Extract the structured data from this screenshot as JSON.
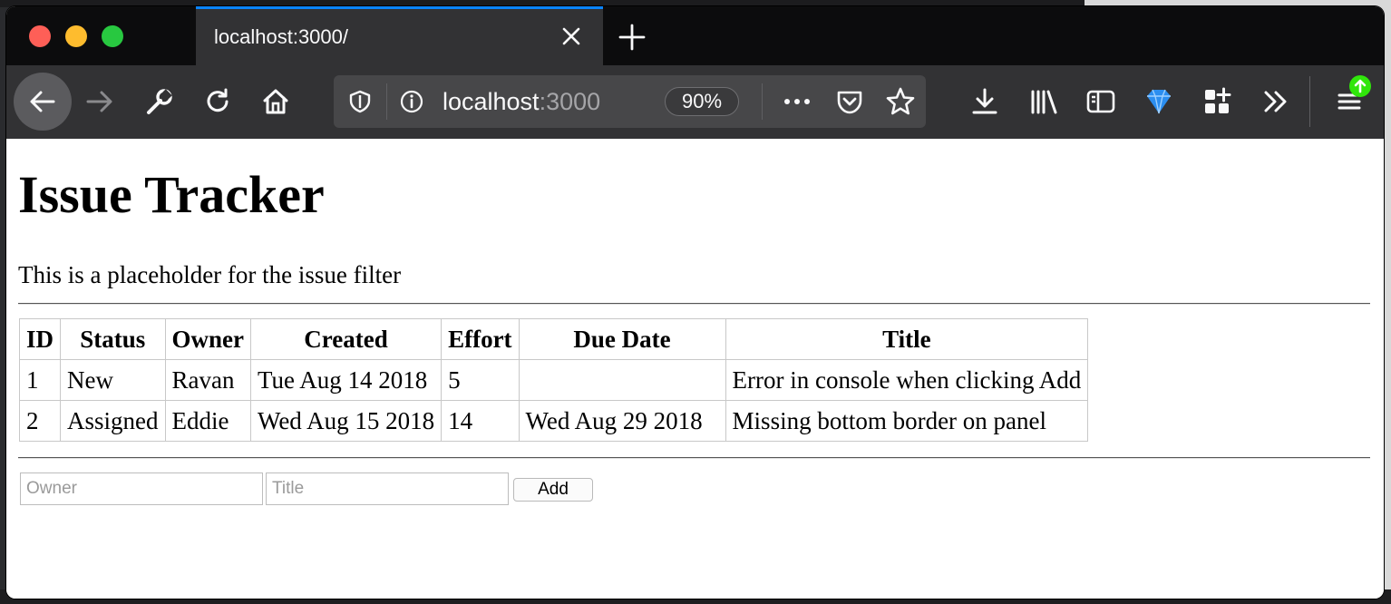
{
  "browser": {
    "tab_title": "localhost:3000/",
    "url_host": "localhost",
    "url_port": ":3000",
    "zoom": "90%",
    "accent_color": "#0a84ff"
  },
  "icons": {
    "toolbar": [
      "back-arrow-icon",
      "forward-arrow-icon",
      "wrench-icon",
      "reload-icon",
      "home-icon"
    ],
    "urlbar": [
      "shield-icon",
      "info-icon",
      "more-icon",
      "pocket-icon",
      "star-icon"
    ],
    "right": [
      "download-icon",
      "library-icon",
      "sidebar-icon",
      "gem-icon",
      "extensions-icon",
      "overflow-icon",
      "menu-icon"
    ]
  },
  "page": {
    "title": "Issue Tracker",
    "filter_placeholder": "This is a placeholder for the issue filter",
    "table": {
      "headers": [
        "ID",
        "Status",
        "Owner",
        "Created",
        "Effort",
        "Due Date",
        "Title"
      ],
      "rows": [
        [
          "1",
          "New",
          "Ravan",
          "Tue Aug 14 2018",
          "5",
          "",
          "Error in console when clicking Add"
        ],
        [
          "2",
          "Assigned",
          "Eddie",
          "Wed Aug 15 2018",
          "14",
          "Wed Aug 29 2018",
          "Missing bottom border on panel"
        ]
      ]
    },
    "form": {
      "owner_placeholder": "Owner",
      "title_placeholder": "Title",
      "add_label": "Add"
    }
  }
}
